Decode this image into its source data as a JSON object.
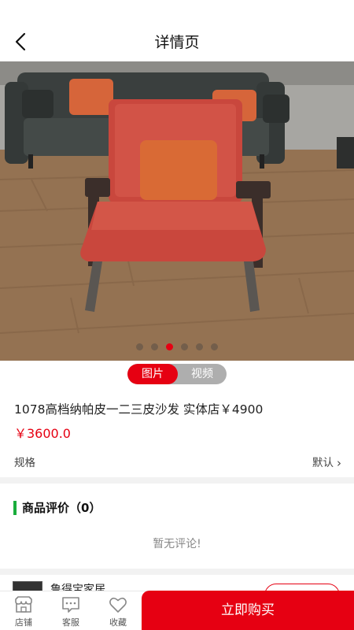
{
  "header": {
    "title": "详情页"
  },
  "gallery": {
    "dot_count": 6,
    "active_index": 2
  },
  "media_toggle": {
    "image_label": "图片",
    "video_label": "视频",
    "selected": "图片"
  },
  "product": {
    "name": "1078高档纳帕皮一二三皮沙发 实体店￥4900",
    "price": "￥3600.0",
    "spec_label": "规格",
    "spec_value": "默认"
  },
  "reviews": {
    "title": "商品评价（0）",
    "empty_text": "暂无评论!"
  },
  "store": {
    "name": "鲁得宝家居"
  },
  "bottom_bar": {
    "tabs": [
      {
        "label": "店铺",
        "icon": "shop-icon"
      },
      {
        "label": "客服",
        "icon": "chat-icon"
      },
      {
        "label": "收藏",
        "icon": "heart-icon"
      }
    ],
    "buy_label": "立即购买"
  },
  "colors": {
    "accent": "#e60012",
    "review_bar": "#1aad3c",
    "toggle_inactive": "#aeaeae"
  }
}
